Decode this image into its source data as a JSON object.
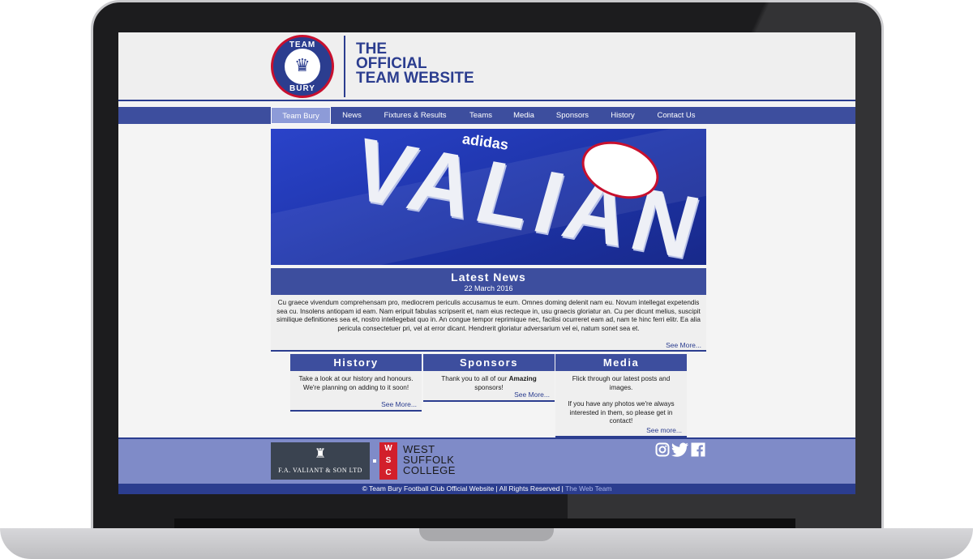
{
  "header": {
    "logo_top": "TEAM",
    "logo_bottom": "BURY",
    "title_line1": "THE",
    "title_line2": "OFFICIAL",
    "title_line3": "TEAM WEBSITE"
  },
  "nav": {
    "items": [
      {
        "label": "Team Bury",
        "active": true
      },
      {
        "label": "News"
      },
      {
        "label": "Fixtures & Results"
      },
      {
        "label": "Teams"
      },
      {
        "label": "Media"
      },
      {
        "label": "Sponsors"
      },
      {
        "label": "History"
      },
      {
        "label": "Contact Us"
      }
    ]
  },
  "hero": {
    "brand": "adidas",
    "shirt_text": "VALIANT"
  },
  "latest_news": {
    "title": "Latest News",
    "date": "22 March 2016",
    "body": "Cu graece vivendum comprehensam pro, mediocrem periculis accusamus te eum. Omnes doming delenit nam eu. Novum intellegat expetendis sea cu. Insolens antiopam id eam. Nam eripuit fabulas scripserit et, nam eius recteque in, usu graecis gloriatur an. Cu per dicunt melius, suscipit similique definitiones sea et, nostro intellegebat quo in. An congue tempor reprimique nec, facilisi ocurreret eam ad, nam te hinc ferri elitr. Ea alia pericula consectetuer pri, vel at error dicant. Hendrerit gloriatur adversarium vel ei, natum sonet sea et.",
    "see_more": "See More..."
  },
  "boxes": {
    "history": {
      "title": "History",
      "body": "Take a look at our history and honours. We're planning on adding to it soon!",
      "see_more": "See More..."
    },
    "sponsors": {
      "title": "Sponsors",
      "body_before": "Thank you to all of our ",
      "body_bold": "Amazing",
      "body_after": " sponsors!",
      "see_more": "See More..."
    },
    "media": {
      "title": "Media",
      "body_p1": "Flick through our latest posts and images.",
      "body_p2": "If you have any photos we're always interested in them, so please get in contact!",
      "see_more": "See more..."
    }
  },
  "footer": {
    "sponsor1": "F.A. VALIANT & SON LTD",
    "sponsor2_letters": [
      "W",
      "S",
      "C"
    ],
    "sponsor2_line1": "WEST",
    "sponsor2_line2": "SUFFOLK",
    "sponsor2_line3": "COLLEGE",
    "social_icons": [
      "instagram-icon",
      "twitter-icon",
      "facebook-icon"
    ],
    "copyright": "© Team Bury Football Club Official Website | All Rights Reserved | ",
    "credit": "The Web Team"
  },
  "colors": {
    "brand_navy": "#2b3d8f",
    "nav_blue": "#3d4e9e",
    "nav_active": "#8d9bd8",
    "footer_blue": "#7f8bc8",
    "accent_red": "#c8102e"
  }
}
